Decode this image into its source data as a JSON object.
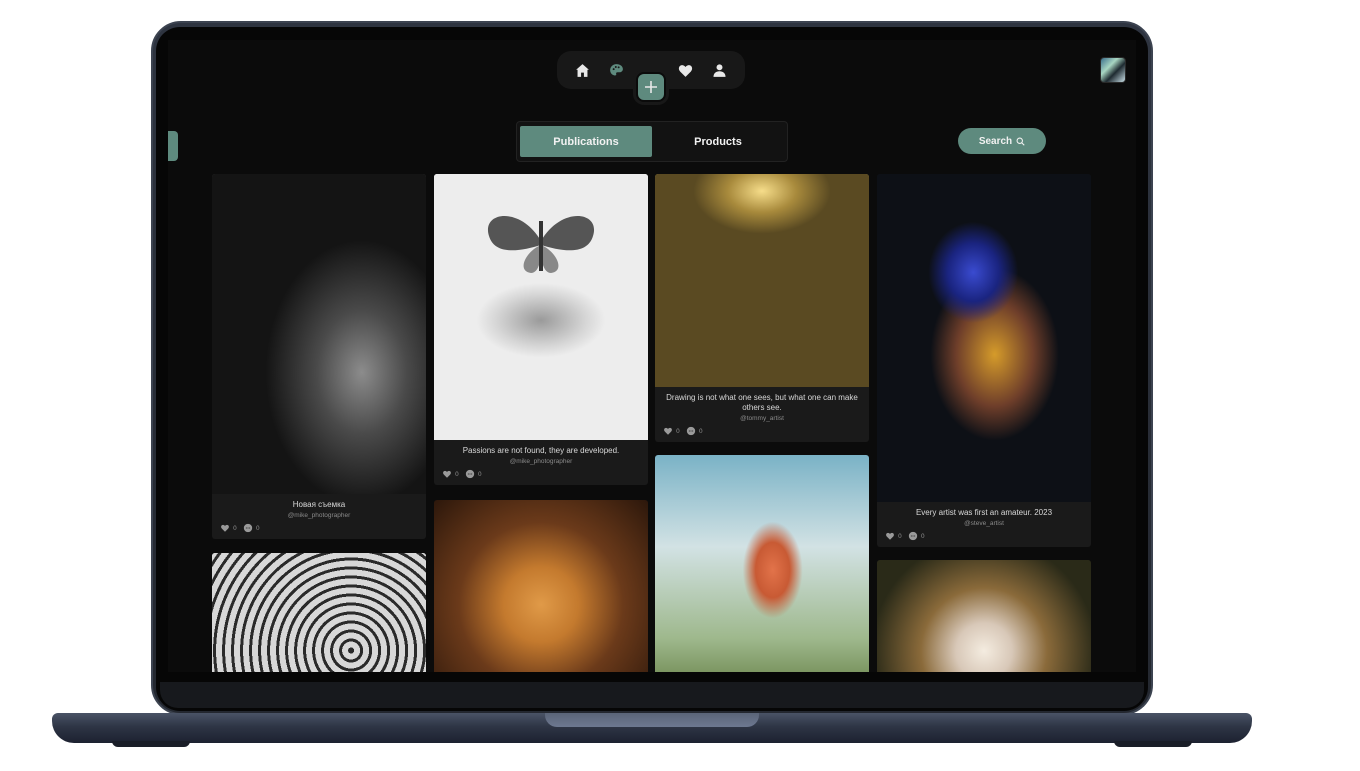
{
  "nav": {
    "items": [
      {
        "icon": "home-icon"
      },
      {
        "icon": "palette-icon"
      },
      {
        "icon": "heart-icon"
      },
      {
        "icon": "user-icon"
      }
    ],
    "add_icon": "plus-icon"
  },
  "tabs": [
    {
      "label": "Publications",
      "active": true
    },
    {
      "label": "Products",
      "active": false
    }
  ],
  "search": {
    "label": "Search"
  },
  "colors": {
    "accent": "#5e8a7e",
    "background": "#0b0b0b",
    "card": "#1a1a1a"
  },
  "posts": [
    {
      "caption": "Новая съемка",
      "author": "@mike_photographer",
      "likes": "0",
      "comments": "0"
    },
    {
      "caption": "Passions are not found, they are developed.",
      "author": "@mike_photographer",
      "likes": "0",
      "comments": "0"
    },
    {
      "caption": "Drawing is not what one sees, but what one can make others see.",
      "author": "@tommy_artist",
      "likes": "0",
      "comments": "0"
    },
    {
      "caption": "Every artist was first an amateur. 2023",
      "author": "@steve_artist",
      "likes": "0",
      "comments": "0"
    }
  ]
}
